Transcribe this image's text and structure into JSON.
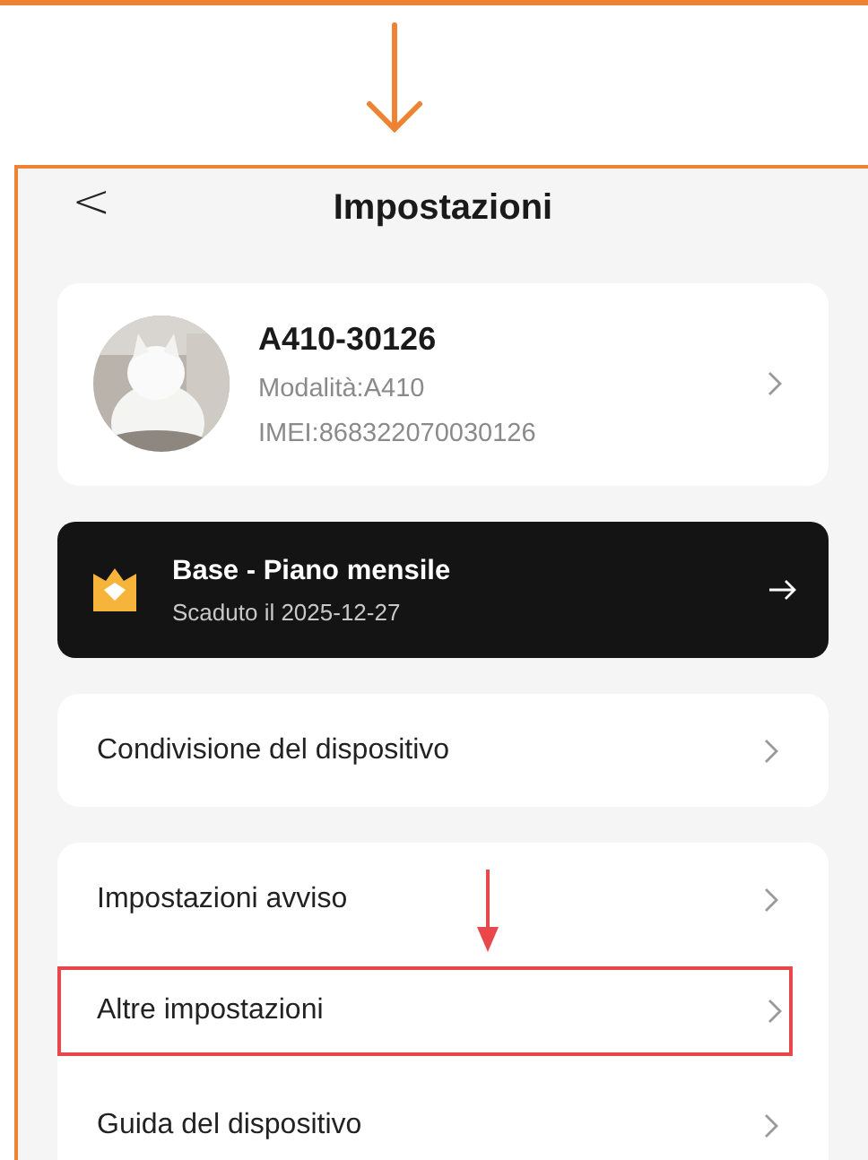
{
  "header": {
    "back": "<",
    "title": "Impostazioni"
  },
  "device": {
    "name": "A410-30126",
    "model": "Modalità:A410",
    "imei": "IMEI:868322070030126"
  },
  "plan": {
    "title": "Base - Piano mensile",
    "expiry": "Scaduto il 2025-12-27"
  },
  "menu_groups": [
    [
      {
        "label": "Condivisione del dispositivo",
        "highlighted": false
      }
    ],
    [
      {
        "label": "Impostazioni avviso",
        "highlighted": false
      },
      {
        "label": "Altre impostazioni",
        "highlighted": true
      },
      {
        "label": "Guida del dispositivo",
        "highlighted": false
      }
    ]
  ]
}
